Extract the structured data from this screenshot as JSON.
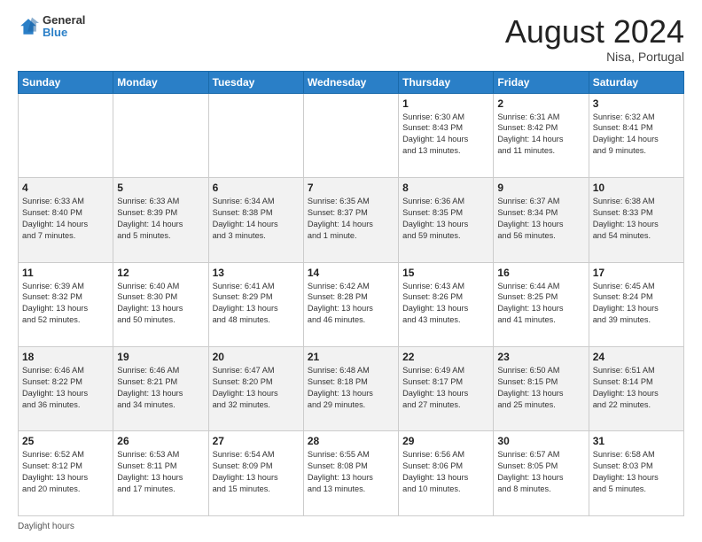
{
  "header": {
    "logo_line1": "General",
    "logo_line2": "Blue",
    "title": "August 2024",
    "subtitle": "Nisa, Portugal"
  },
  "days_of_week": [
    "Sunday",
    "Monday",
    "Tuesday",
    "Wednesday",
    "Thursday",
    "Friday",
    "Saturday"
  ],
  "footer_label": "Daylight hours",
  "weeks": [
    [
      {
        "day": "",
        "info": ""
      },
      {
        "day": "",
        "info": ""
      },
      {
        "day": "",
        "info": ""
      },
      {
        "day": "",
        "info": ""
      },
      {
        "day": "1",
        "info": "Sunrise: 6:30 AM\nSunset: 8:43 PM\nDaylight: 14 hours\nand 13 minutes."
      },
      {
        "day": "2",
        "info": "Sunrise: 6:31 AM\nSunset: 8:42 PM\nDaylight: 14 hours\nand 11 minutes."
      },
      {
        "day": "3",
        "info": "Sunrise: 6:32 AM\nSunset: 8:41 PM\nDaylight: 14 hours\nand 9 minutes."
      }
    ],
    [
      {
        "day": "4",
        "info": "Sunrise: 6:33 AM\nSunset: 8:40 PM\nDaylight: 14 hours\nand 7 minutes."
      },
      {
        "day": "5",
        "info": "Sunrise: 6:33 AM\nSunset: 8:39 PM\nDaylight: 14 hours\nand 5 minutes."
      },
      {
        "day": "6",
        "info": "Sunrise: 6:34 AM\nSunset: 8:38 PM\nDaylight: 14 hours\nand 3 minutes."
      },
      {
        "day": "7",
        "info": "Sunrise: 6:35 AM\nSunset: 8:37 PM\nDaylight: 14 hours\nand 1 minute."
      },
      {
        "day": "8",
        "info": "Sunrise: 6:36 AM\nSunset: 8:35 PM\nDaylight: 13 hours\nand 59 minutes."
      },
      {
        "day": "9",
        "info": "Sunrise: 6:37 AM\nSunset: 8:34 PM\nDaylight: 13 hours\nand 56 minutes."
      },
      {
        "day": "10",
        "info": "Sunrise: 6:38 AM\nSunset: 8:33 PM\nDaylight: 13 hours\nand 54 minutes."
      }
    ],
    [
      {
        "day": "11",
        "info": "Sunrise: 6:39 AM\nSunset: 8:32 PM\nDaylight: 13 hours\nand 52 minutes."
      },
      {
        "day": "12",
        "info": "Sunrise: 6:40 AM\nSunset: 8:30 PM\nDaylight: 13 hours\nand 50 minutes."
      },
      {
        "day": "13",
        "info": "Sunrise: 6:41 AM\nSunset: 8:29 PM\nDaylight: 13 hours\nand 48 minutes."
      },
      {
        "day": "14",
        "info": "Sunrise: 6:42 AM\nSunset: 8:28 PM\nDaylight: 13 hours\nand 46 minutes."
      },
      {
        "day": "15",
        "info": "Sunrise: 6:43 AM\nSunset: 8:26 PM\nDaylight: 13 hours\nand 43 minutes."
      },
      {
        "day": "16",
        "info": "Sunrise: 6:44 AM\nSunset: 8:25 PM\nDaylight: 13 hours\nand 41 minutes."
      },
      {
        "day": "17",
        "info": "Sunrise: 6:45 AM\nSunset: 8:24 PM\nDaylight: 13 hours\nand 39 minutes."
      }
    ],
    [
      {
        "day": "18",
        "info": "Sunrise: 6:46 AM\nSunset: 8:22 PM\nDaylight: 13 hours\nand 36 minutes."
      },
      {
        "day": "19",
        "info": "Sunrise: 6:46 AM\nSunset: 8:21 PM\nDaylight: 13 hours\nand 34 minutes."
      },
      {
        "day": "20",
        "info": "Sunrise: 6:47 AM\nSunset: 8:20 PM\nDaylight: 13 hours\nand 32 minutes."
      },
      {
        "day": "21",
        "info": "Sunrise: 6:48 AM\nSunset: 8:18 PM\nDaylight: 13 hours\nand 29 minutes."
      },
      {
        "day": "22",
        "info": "Sunrise: 6:49 AM\nSunset: 8:17 PM\nDaylight: 13 hours\nand 27 minutes."
      },
      {
        "day": "23",
        "info": "Sunrise: 6:50 AM\nSunset: 8:15 PM\nDaylight: 13 hours\nand 25 minutes."
      },
      {
        "day": "24",
        "info": "Sunrise: 6:51 AM\nSunset: 8:14 PM\nDaylight: 13 hours\nand 22 minutes."
      }
    ],
    [
      {
        "day": "25",
        "info": "Sunrise: 6:52 AM\nSunset: 8:12 PM\nDaylight: 13 hours\nand 20 minutes."
      },
      {
        "day": "26",
        "info": "Sunrise: 6:53 AM\nSunset: 8:11 PM\nDaylight: 13 hours\nand 17 minutes."
      },
      {
        "day": "27",
        "info": "Sunrise: 6:54 AM\nSunset: 8:09 PM\nDaylight: 13 hours\nand 15 minutes."
      },
      {
        "day": "28",
        "info": "Sunrise: 6:55 AM\nSunset: 8:08 PM\nDaylight: 13 hours\nand 13 minutes."
      },
      {
        "day": "29",
        "info": "Sunrise: 6:56 AM\nSunset: 8:06 PM\nDaylight: 13 hours\nand 10 minutes."
      },
      {
        "day": "30",
        "info": "Sunrise: 6:57 AM\nSunset: 8:05 PM\nDaylight: 13 hours\nand 8 minutes."
      },
      {
        "day": "31",
        "info": "Sunrise: 6:58 AM\nSunset: 8:03 PM\nDaylight: 13 hours\nand 5 minutes."
      }
    ]
  ]
}
